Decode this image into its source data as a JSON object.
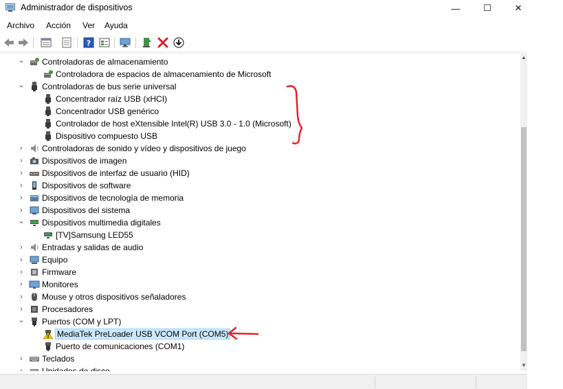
{
  "window": {
    "title": "Administrador de dispositivos",
    "minimize_glyph": "—",
    "maximize_glyph": "☐",
    "close_glyph": "✕"
  },
  "menu": [
    "Archivo",
    "Acción",
    "Ver",
    "Ayuda"
  ],
  "toolbar_icons": [
    "back-icon",
    "forward-icon",
    "properties-icon",
    "device-view-icon",
    "help-icon",
    "resources-icon",
    "monitor-icon",
    "update-driver-icon",
    "uninstall-icon",
    "download-icon"
  ],
  "tree": [
    {
      "level": 1,
      "label": "Controladoras de almacenamiento",
      "expanded": true,
      "icon": "storage-controller-icon"
    },
    {
      "level": 2,
      "label": "Controladora de espacios de almacenamiento de Microsoft",
      "icon": "storage-controller-icon"
    },
    {
      "level": 1,
      "label": "Controladoras de bus serie universal",
      "expanded": true,
      "icon": "usb-icon"
    },
    {
      "level": 2,
      "label": "Concentrador raíz USB (xHCI)",
      "icon": "usb-icon"
    },
    {
      "level": 2,
      "label": "Concentrador USB genérico",
      "icon": "usb-icon"
    },
    {
      "level": 2,
      "label": "Controlador de host eXtensible Intel(R) USB 3.0 - 1.0 (Microsoft)",
      "icon": "usb-icon"
    },
    {
      "level": 2,
      "label": "Dispositivo compuesto USB",
      "icon": "usb-icon"
    },
    {
      "level": 1,
      "label": "Controladoras de sonido y vídeo y dispositivos de juego",
      "expanded": false,
      "icon": "speaker-icon"
    },
    {
      "level": 1,
      "label": "Dispositivos de imagen",
      "expanded": false,
      "icon": "camera-icon"
    },
    {
      "level": 1,
      "label": "Dispositivos de interfaz de usuario (HID)",
      "expanded": false,
      "icon": "hid-icon"
    },
    {
      "level": 1,
      "label": "Dispositivos de software",
      "expanded": false,
      "icon": "software-device-icon"
    },
    {
      "level": 1,
      "label": "Dispositivos de tecnología de memoria",
      "expanded": false,
      "icon": "memory-icon"
    },
    {
      "level": 1,
      "label": "Dispositivos del sistema",
      "expanded": false,
      "icon": "system-device-icon"
    },
    {
      "level": 1,
      "label": "Dispositivos multimedia digitales",
      "expanded": true,
      "icon": "media-device-icon"
    },
    {
      "level": 2,
      "label": "[TV]Samsung LED55",
      "icon": "media-device-icon"
    },
    {
      "level": 1,
      "label": "Entradas y salidas de audio",
      "expanded": false,
      "icon": "speaker-icon"
    },
    {
      "level": 1,
      "label": "Equipo",
      "expanded": false,
      "icon": "computer-icon"
    },
    {
      "level": 1,
      "label": "Firmware",
      "expanded": false,
      "icon": "firmware-icon"
    },
    {
      "level": 1,
      "label": "Monitores",
      "expanded": false,
      "icon": "monitor-icon"
    },
    {
      "level": 1,
      "label": "Mouse y otros dispositivos señaladores",
      "expanded": false,
      "icon": "mouse-icon"
    },
    {
      "level": 1,
      "label": "Procesadores",
      "expanded": false,
      "icon": "processor-icon"
    },
    {
      "level": 1,
      "label": "Puertos (COM y LPT)",
      "expanded": true,
      "icon": "port-icon"
    },
    {
      "level": 2,
      "label": "MediaTek PreLoader USB VCOM Port (COM5)",
      "icon": "warning-port-icon",
      "selected": true
    },
    {
      "level": 2,
      "label": "Puerto de comunicaciones (COM1)",
      "icon": "port-icon"
    },
    {
      "level": 1,
      "label": "Teclados",
      "expanded": false,
      "icon": "keyboard-icon"
    },
    {
      "level": 1,
      "label": "Unidades de disco",
      "expanded": false,
      "icon": "disk-icon"
    }
  ],
  "annotation_color": "#e8202a"
}
